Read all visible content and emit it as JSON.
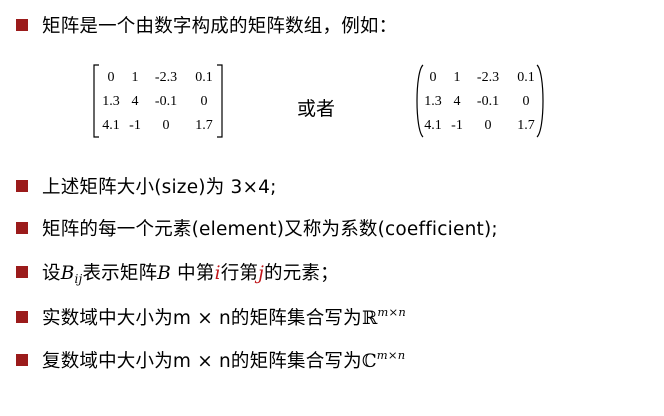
{
  "bullets": {
    "b1": "矩阵是一个由数字构成的矩阵数组，例如：",
    "b2": "上述矩阵大小(size)为 3×4;",
    "b3": "矩阵的每一个元素(element)又称为系数(coefficient);",
    "b4": {
      "pre": "设",
      "var": "B",
      "sub": "ij",
      "mid1": "表示矩阵",
      "var2": "B",
      "mid2": " 中第",
      "i": "i",
      "mid3": "行第",
      "j": "j",
      "post": "的元素；"
    },
    "b5": {
      "text": "实数域中大小为m × n的矩阵集合写为",
      "set": "ℝ",
      "sup": "m×n"
    },
    "b6": {
      "text": "复数域中大小为m × n的矩阵集合写为",
      "set": "ℂ",
      "sup": "m×n"
    }
  },
  "matrix_left": {
    "rows": [
      [
        "0",
        "1",
        "-2.3",
        "0.1"
      ],
      [
        "1.3",
        "4",
        "-0.1",
        "0"
      ],
      [
        "4.1",
        "-1",
        "0",
        "1.7"
      ]
    ]
  },
  "or_word": "或者",
  "matrix_right": {
    "rows": [
      [
        "0",
        "1",
        "-2.3",
        "0.1"
      ],
      [
        "1.3",
        "4",
        "-0.1",
        "0"
      ],
      [
        "4.1",
        "-1",
        "0",
        "1.7"
      ]
    ]
  },
  "colors": {
    "bullet": "#9b1b1b",
    "highlight": "#c0161a"
  }
}
